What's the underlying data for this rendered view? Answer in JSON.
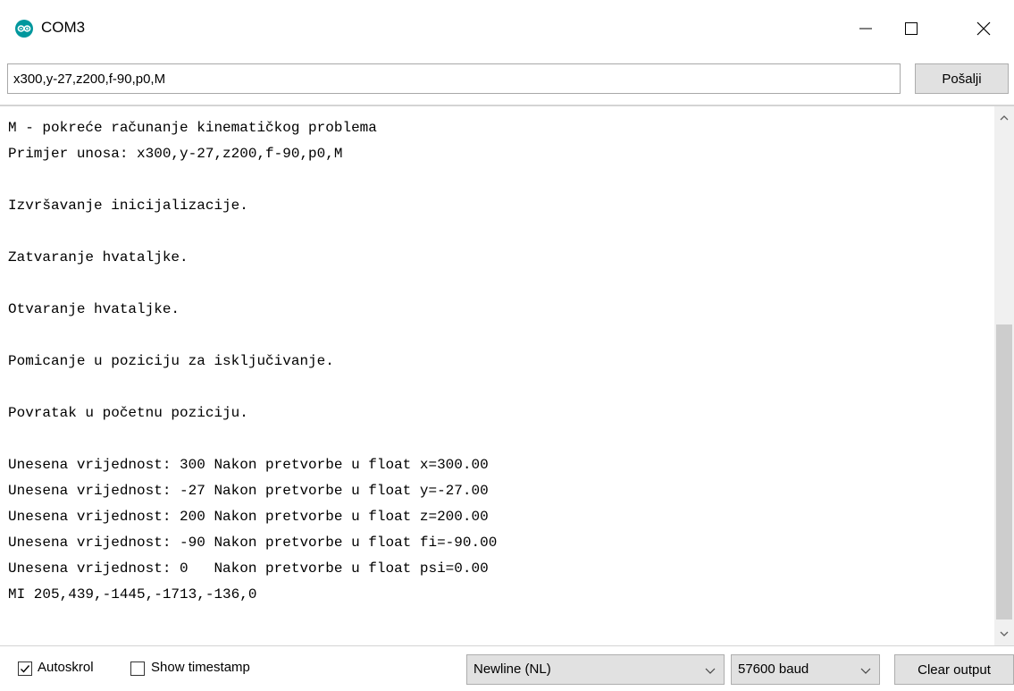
{
  "window": {
    "title": "COM3",
    "app_icon": "arduino-icon",
    "controls": [
      "minimize-icon",
      "maximize-icon",
      "close-icon"
    ]
  },
  "send": {
    "input_value": "x300,y-27,z200,f-90,p0,M",
    "button_label": "Pošalji"
  },
  "output": {
    "lines": [
      "M - pokreće računanje kinematičkog problema",
      "Primjer unosa: x300,y-27,z200,f-90,p0,M",
      "",
      "Izvršavanje inicijalizacije.",
      "",
      "Zatvaranje hvataljke.",
      "",
      "Otvaranje hvataljke.",
      "",
      "Pomicanje u poziciju za isključivanje.",
      "",
      "Povratak u početnu poziciju.",
      "",
      "Unesena vrijednost: 300 Nakon pretvorbe u float x=300.00",
      "Unesena vrijednost: -27 Nakon pretvorbe u float y=-27.00",
      "Unesena vrijednost: 200 Nakon pretvorbe u float z=200.00",
      "Unesena vrijednost: -90 Nakon pretvorbe u float fi=-90.00",
      "Unesena vrijednost: 0   Nakon pretvorbe u float psi=0.00",
      "MI 205,439,-1445,-1713,-136,0"
    ]
  },
  "footer": {
    "autoscroll_label": "Autoskrol",
    "autoscroll_checked": true,
    "timestamp_label": "Show timestamp",
    "timestamp_checked": false,
    "line_ending": "Newline (NL)",
    "baud_rate": "57600 baud",
    "clear_label": "Clear output"
  },
  "colors": {
    "arduino_teal": "#00979d",
    "button_face": "#e1e1e1",
    "scroll_thumb": "#cdcdcd"
  }
}
